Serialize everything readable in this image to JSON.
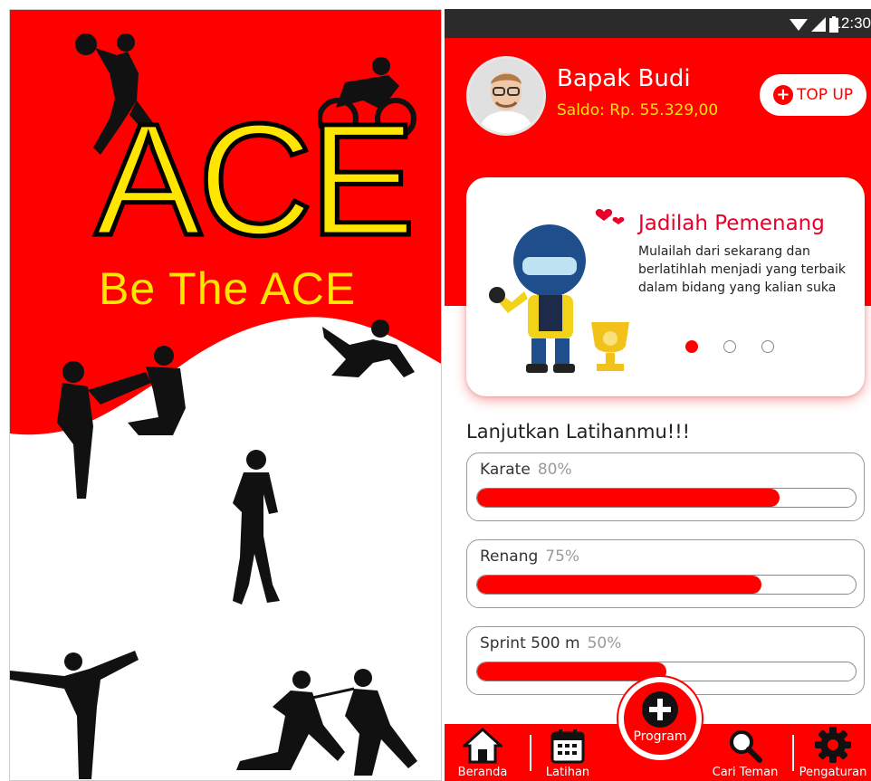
{
  "splash": {
    "title": "ACE",
    "tagline": "Be The ACE",
    "colors": {
      "background_top": "#ff0000",
      "background_bottom": "#ffffff",
      "title": "#ffe600",
      "silhouette": "#111111"
    },
    "silhouettes": [
      "basketball-player",
      "cyclist",
      "skater",
      "martial-artists-sparring",
      "runner",
      "yoga-pose",
      "fencers"
    ]
  },
  "status_bar": {
    "time": "12:30",
    "icons": [
      "wifi-icon",
      "signal-icon",
      "battery-icon"
    ]
  },
  "profile": {
    "name": "Bapak Budi",
    "balance": "Saldo: Rp. 55.329,00",
    "topup_icon": "plus-circle-icon",
    "topup_label": "TOP UP"
  },
  "banner": {
    "title": "Jadilah Pemenang",
    "text": "Mulailah dari sekarang dan berlatihlah menjadi yang terbaik dalam bidang yang kalian suka",
    "illustration": "racer-with-trophy",
    "pager": {
      "count": 3,
      "active": 0
    }
  },
  "progress": {
    "title": "Lanjutkan Latihanmu!!!",
    "items": [
      {
        "name": "Karate",
        "percent_label": "80%",
        "value": 0.8
      },
      {
        "name": "Renang",
        "percent_label": "75%",
        "value": 0.75
      },
      {
        "name": "Sprint 500 m",
        "percent_label": "50%",
        "value": 0.5
      }
    ]
  },
  "nav": {
    "items": [
      {
        "label": "Beranda",
        "icon": "home-icon"
      },
      {
        "label": "Latihan",
        "icon": "calendar-icon"
      },
      {
        "label": "Cari Teman",
        "icon": "search-icon"
      },
      {
        "label": "Pengaturan",
        "icon": "gear-icon"
      }
    ],
    "fab": {
      "label": "Program",
      "icon": "plus-icon"
    }
  },
  "colors": {
    "primary": "#ff0000",
    "accent": "#ffe600",
    "statusbar": "#2b2b2b"
  }
}
